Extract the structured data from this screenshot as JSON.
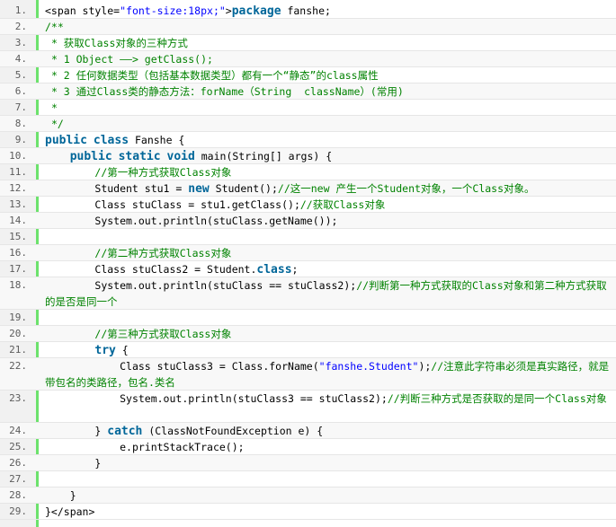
{
  "code_viewer": {
    "colors": {
      "keyword": "#006699",
      "comment": "#008200",
      "string": "#0000ff",
      "gutter_border": "#6ce26c",
      "line_number": "#5c5c5c"
    },
    "lines": [
      {
        "n": "1.",
        "h": 18,
        "tokens": [
          {
            "t": "<span style=",
            "k": "pl"
          },
          {
            "t": "\"font-size:18px;\"",
            "k": "str"
          },
          {
            "t": ">",
            "k": "pl"
          },
          {
            "t": "package",
            "k": "kw-big"
          },
          {
            "t": " fanshe;",
            "k": "pl"
          }
        ]
      },
      {
        "n": "2.",
        "h": 18,
        "tokens": [
          {
            "t": "/**",
            "k": "cm"
          }
        ]
      },
      {
        "n": "3.",
        "h": 18,
        "tokens": [
          {
            "t": " * 获取Class对象的三种方式",
            "k": "cm"
          }
        ]
      },
      {
        "n": "4.",
        "h": 18,
        "tokens": [
          {
            "t": " * 1 Object ——> getClass();",
            "k": "cm"
          }
        ]
      },
      {
        "n": "5.",
        "h": 18,
        "tokens": [
          {
            "t": " * 2 任何数据类型（包括基本数据类型）都有一个“静态”的class属性",
            "k": "cm"
          }
        ]
      },
      {
        "n": "6.",
        "h": 18,
        "tokens": [
          {
            "t": " * 3 通过Class类的静态方法：forName（String  className）(常用)",
            "k": "cm"
          }
        ]
      },
      {
        "n": "7.",
        "h": 18,
        "tokens": [
          {
            "t": " *",
            "k": "cm"
          }
        ]
      },
      {
        "n": "8.",
        "h": 18,
        "tokens": [
          {
            "t": " */",
            "k": "cm"
          }
        ]
      },
      {
        "n": "9.",
        "h": 18,
        "tokens": [
          {
            "t": "public",
            "k": "kw-big"
          },
          {
            "t": " ",
            "k": "pl"
          },
          {
            "t": "class",
            "k": "kw-big"
          },
          {
            "t": " Fanshe {",
            "k": "pl"
          }
        ]
      },
      {
        "n": "10.",
        "h": 18,
        "tokens": [
          {
            "t": "    ",
            "k": "pl"
          },
          {
            "t": "public",
            "k": "kw-big"
          },
          {
            "t": " ",
            "k": "pl"
          },
          {
            "t": "static",
            "k": "kw-big"
          },
          {
            "t": " ",
            "k": "pl"
          },
          {
            "t": "void",
            "k": "kw-big"
          },
          {
            "t": " main(String[] args) {",
            "k": "pl"
          }
        ]
      },
      {
        "n": "11.",
        "h": 18,
        "tokens": [
          {
            "t": "        ",
            "k": "pl"
          },
          {
            "t": "//第一种方式获取Class对象",
            "k": "cm"
          }
        ]
      },
      {
        "n": "12.",
        "h": 18,
        "tokens": [
          {
            "t": "        Student stu1 = ",
            "k": "pl"
          },
          {
            "t": "new",
            "k": "kw-big"
          },
          {
            "t": " Student();",
            "k": "pl"
          },
          {
            "t": "//这一new 产生一个Student对象，一个Class对象。",
            "k": "cm"
          }
        ]
      },
      {
        "n": "13.",
        "h": 18,
        "tokens": [
          {
            "t": "        Class stuClass = stu1.getClass();",
            "k": "pl"
          },
          {
            "t": "//获取Class对象",
            "k": "cm"
          }
        ]
      },
      {
        "n": "14.",
        "h": 18,
        "tokens": [
          {
            "t": "        System.out.println(stuClass.getName());",
            "k": "pl"
          }
        ]
      },
      {
        "n": "15.",
        "h": 18,
        "tokens": [
          {
            "t": "",
            "k": "pl"
          }
        ]
      },
      {
        "n": "16.",
        "h": 18,
        "tokens": [
          {
            "t": "        ",
            "k": "pl"
          },
          {
            "t": "//第二种方式获取Class对象",
            "k": "cm"
          }
        ]
      },
      {
        "n": "17.",
        "h": 18,
        "tokens": [
          {
            "t": "        Class stuClass2 = Student.",
            "k": "pl"
          },
          {
            "t": "class",
            "k": "kw-big"
          },
          {
            "t": ";",
            "k": "pl"
          }
        ]
      },
      {
        "n": "18.",
        "h": 36,
        "tokens": [
          {
            "t": "        System.out.println(stuClass == stuClass2);",
            "k": "pl"
          },
          {
            "t": "//判断第一种方式获取的Class对象和第二种方式获取的是否是同一个",
            "k": "cm"
          }
        ]
      },
      {
        "n": "19.",
        "h": 18,
        "tokens": [
          {
            "t": "",
            "k": "pl"
          }
        ]
      },
      {
        "n": "20.",
        "h": 18,
        "tokens": [
          {
            "t": "        ",
            "k": "pl"
          },
          {
            "t": "//第三种方式获取Class对象",
            "k": "cm"
          }
        ]
      },
      {
        "n": "21.",
        "h": 18,
        "tokens": [
          {
            "t": "        ",
            "k": "pl"
          },
          {
            "t": "try",
            "k": "kw-big"
          },
          {
            "t": " {",
            "k": "pl"
          }
        ]
      },
      {
        "n": "22.",
        "h": 36,
        "tokens": [
          {
            "t": "            Class stuClass3 = Class.forName(",
            "k": "pl"
          },
          {
            "t": "\"fanshe.Student\"",
            "k": "str"
          },
          {
            "t": ");",
            "k": "pl"
          },
          {
            "t": "//注意此字符串必须是真实路径，就是带包名的类路径，包名.类名",
            "k": "cm"
          }
        ]
      },
      {
        "n": "23.",
        "h": 36,
        "tokens": [
          {
            "t": "            System.out.println(stuClass3 == stuClass2);",
            "k": "pl"
          },
          {
            "t": "//判断三种方式是否获取的是同一个Class对象",
            "k": "cm"
          }
        ]
      },
      {
        "n": "24.",
        "h": 18,
        "tokens": [
          {
            "t": "        } ",
            "k": "pl"
          },
          {
            "t": "catch",
            "k": "kw-big"
          },
          {
            "t": " (ClassNotFoundException e) {",
            "k": "pl"
          }
        ]
      },
      {
        "n": "25.",
        "h": 18,
        "tokens": [
          {
            "t": "            e.printStackTrace();",
            "k": "pl"
          }
        ]
      },
      {
        "n": "26.",
        "h": 18,
        "tokens": [
          {
            "t": "        }",
            "k": "pl"
          }
        ]
      },
      {
        "n": "27.",
        "h": 18,
        "tokens": [
          {
            "t": "",
            "k": "pl"
          }
        ]
      },
      {
        "n": "28.",
        "h": 18,
        "tokens": [
          {
            "t": "    }",
            "k": "pl"
          }
        ]
      },
      {
        "n": "29.",
        "h": 18,
        "tokens": [
          {
            "t": "}</span>",
            "k": "pl"
          }
        ]
      }
    ]
  }
}
